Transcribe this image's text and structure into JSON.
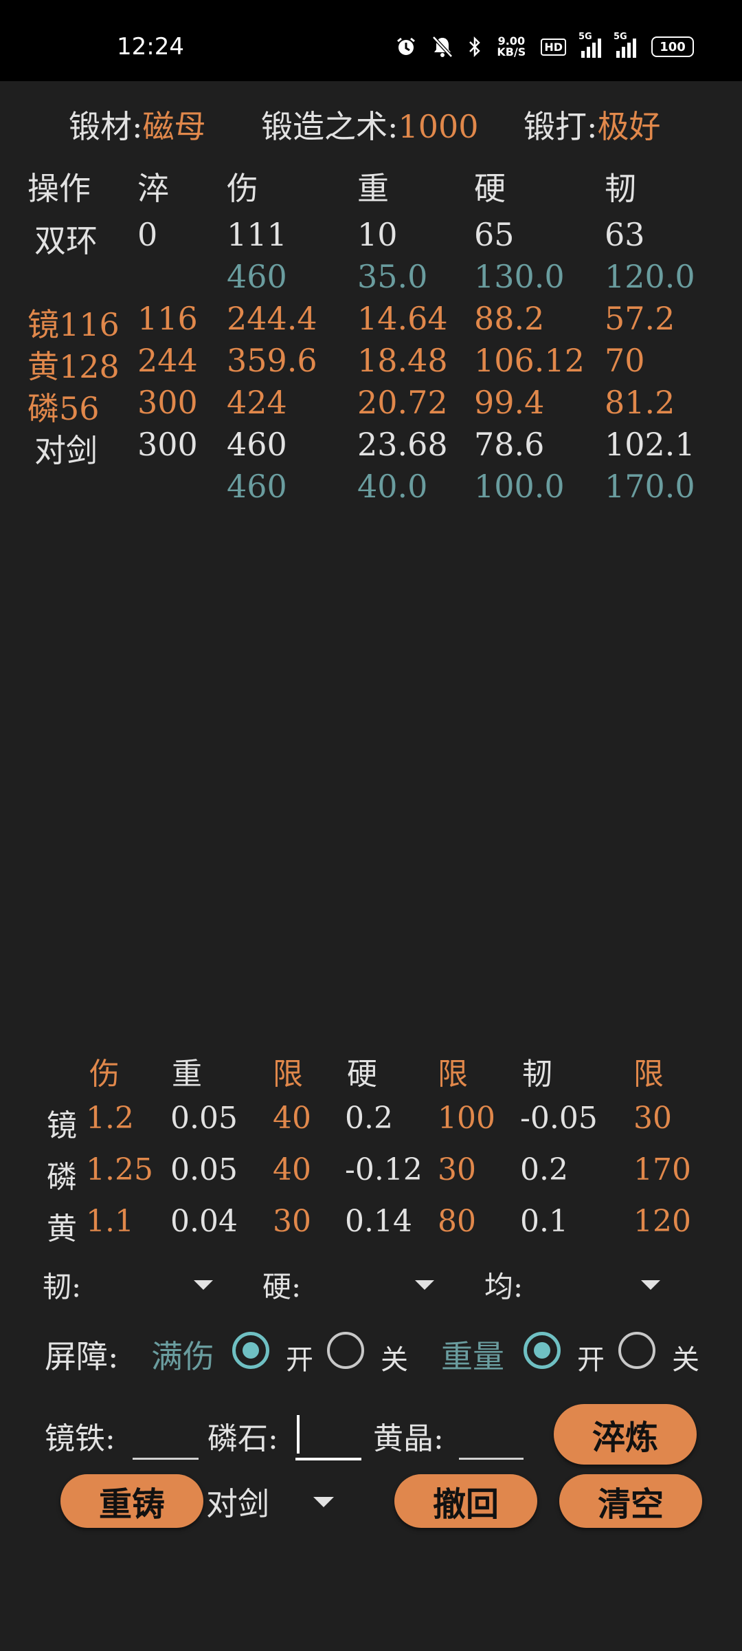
{
  "status_bar": {
    "time": "12:24",
    "speed_value": "9.00",
    "speed_unit": "KB/S",
    "hd": "HD",
    "net1": "5G",
    "net2": "5G",
    "battery": "100"
  },
  "header": {
    "material_label": "锻材:",
    "material_value": "磁母",
    "skill_label": "锻造之术:",
    "skill_value": "1000",
    "forge_label": "锻打:",
    "forge_value": "极好"
  },
  "table": {
    "columns": [
      "操作",
      "淬",
      "伤",
      "重",
      "硬",
      "韧"
    ],
    "rows": [
      {
        "color": "white",
        "cells": [
          "双环",
          "0",
          "111",
          "10",
          "65",
          "63"
        ]
      },
      {
        "color": "teal",
        "cells": [
          "",
          "",
          "460",
          "35.0",
          "130.0",
          "120.0"
        ]
      },
      {
        "color": "orange",
        "cells": [
          "镜116",
          "116",
          "244.4",
          "14.64",
          "88.2",
          "57.2"
        ]
      },
      {
        "color": "orange",
        "cells": [
          "黄128",
          "244",
          "359.6",
          "18.48",
          "106.12",
          "70"
        ]
      },
      {
        "color": "orange",
        "cells": [
          "磷56",
          "300",
          "424",
          "20.72",
          "99.4",
          "81.2"
        ]
      },
      {
        "color": "white",
        "cells": [
          "对剑",
          "300",
          "460",
          "23.68",
          "78.6",
          "102.1"
        ]
      },
      {
        "color": "teal",
        "cells": [
          "",
          "",
          "460",
          "40.0",
          "100.0",
          "170.0"
        ]
      }
    ]
  },
  "coef": {
    "headers": [
      "伤",
      "重",
      "限",
      "硬",
      "限",
      "韧",
      "限"
    ],
    "rows": [
      {
        "name": "镜",
        "vals": [
          "1.2",
          "0.05",
          "40",
          "0.2",
          "100",
          "-0.05",
          "30"
        ]
      },
      {
        "name": "磷",
        "vals": [
          "1.25",
          "0.05",
          "40",
          "-0.12",
          "30",
          "0.2",
          "170"
        ]
      },
      {
        "name": "黄",
        "vals": [
          "1.1",
          "0.04",
          "30",
          "0.14",
          "80",
          "0.1",
          "120"
        ]
      }
    ]
  },
  "dropdowns": {
    "toughness": "韧:",
    "hardness": "硬:",
    "balance": "均:"
  },
  "barrier": {
    "label": "屏障:",
    "full_damage": "满伤",
    "weight": "重量",
    "on": "开",
    "off": "关",
    "full_damage_on": true,
    "weight_on": true
  },
  "inputs": {
    "mirror_iron": "镜铁:",
    "phosphor": "磷石:",
    "yellow_crystal": "黄晶:"
  },
  "buttons": {
    "quench": "淬炼",
    "recast": "重铸",
    "undo": "撤回",
    "clear": "清空"
  },
  "weapon_select": {
    "value": "对剑"
  },
  "colors": {
    "orange": "#e1884b",
    "teal": "#6a9d9f",
    "button": "#e0874d",
    "radio": "#6fc0c3",
    "background": "#1f1f1f"
  }
}
